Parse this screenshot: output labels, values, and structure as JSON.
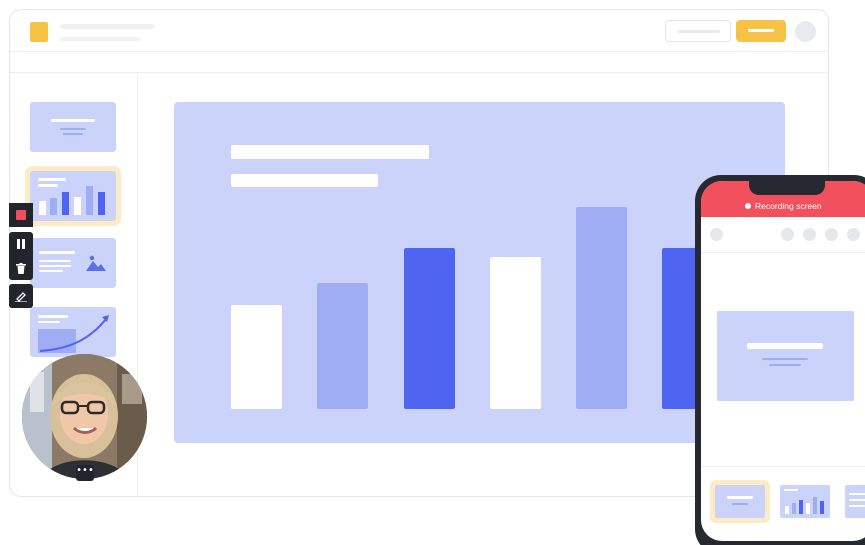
{
  "phone": {
    "recording_status": "Recording screen"
  },
  "webcam": {
    "more_label": "•••"
  },
  "controls": {
    "stop": "stop-icon",
    "pause": "pause-icon",
    "delete": "trash-icon",
    "annotate": "pen-icon"
  },
  "colors": {
    "accent_yellow": "#f6c344",
    "slide_bg": "#cbd3fb",
    "bar_light": "#9fadf5",
    "bar_dark": "#4f64f0",
    "record_red": "#f1505c",
    "control_dark": "#22252c"
  }
}
